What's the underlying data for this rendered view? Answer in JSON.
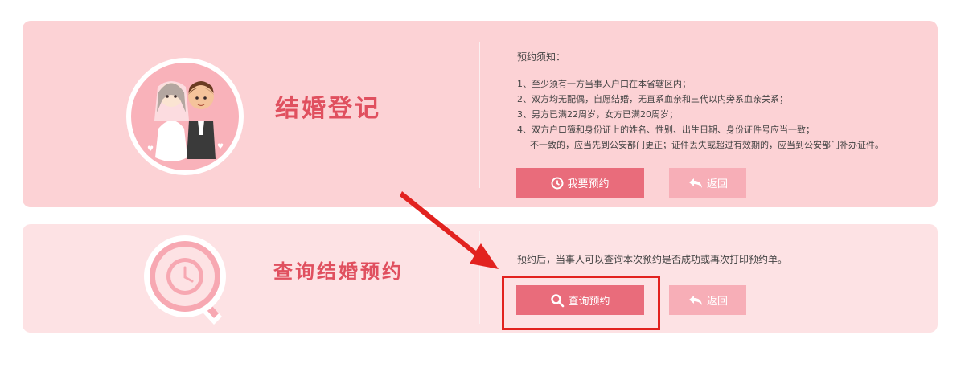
{
  "registration": {
    "title": "结婚登记",
    "notice_title": "预约须知：",
    "notice_items": [
      "1、至少须有一方当事人户口在本省辖区内；",
      "2、双方均无配偶，自愿结婚，无直系血亲和三代以内旁系血亲关系；",
      "3、男方已满22周岁，女方已满20周岁；",
      "4、双方户口簿和身份证上的姓名、性别、出生日期、身份证件号应当一致；",
      "不一致的，应当先到公安部门更正；证件丢失或超过有效期的，应当到公安部门补办证件。"
    ],
    "primary_button": "我要预约",
    "back_button": "返回"
  },
  "query": {
    "title": "查询结婚预约",
    "info": "预约后，当事人可以查询本次预约是否成功或再次打印预约单。",
    "primary_button": "查询预约",
    "back_button": "返回"
  },
  "icons": {
    "couple": "couple-icon",
    "query": "magnifier-clock-icon",
    "clock": "clock-icon",
    "search": "search-icon",
    "back": "back-arrow-icon"
  },
  "colors": {
    "card_top": "#fcd2d5",
    "card_bottom": "#fde2e4",
    "button_primary": "#e96c7b",
    "button_back": "#f7aeb7",
    "title": "#e0505f",
    "annotation": "#e2221f"
  }
}
